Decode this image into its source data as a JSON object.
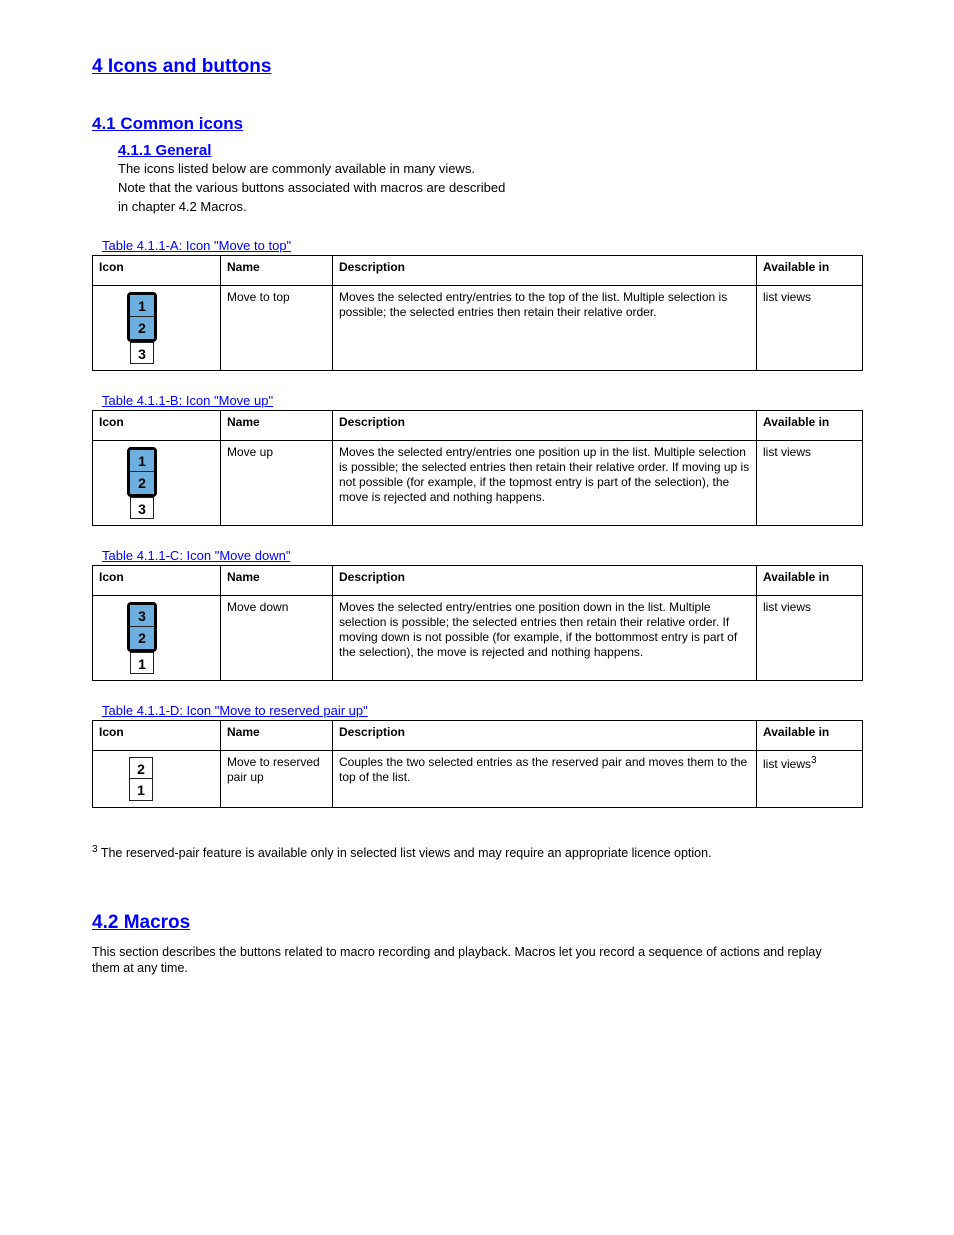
{
  "heading": "4   Icons and buttons",
  "sec4_1": {
    "title": "4.1   Common icons",
    "sub": {
      "title": "4.1.1   General",
      "text_1": "The icons listed below are commonly available in many views.",
      "text_2": "Note that the various buttons associated with macros are described",
      "text_3": "in chapter 4.2 Macros."
    }
  },
  "tableHeaders": [
    "Icon",
    "Name",
    "Description",
    "Available in"
  ],
  "tables": [
    {
      "caption": "Table 4.1.1-A: Icon \"Move to top\"",
      "icon": {
        "type": "dom_blue_top",
        "c1": "1",
        "c2": "2",
        "c3": "3"
      },
      "name": "Move to top",
      "desc": "Moves the selected entry/entries to the top of the list. Multiple selection is possible; the selected entries then retain their relative order.",
      "where": "list views"
    },
    {
      "caption": "Table 4.1.1-B: Icon \"Move up\"",
      "icon": {
        "type": "dom_blue_top",
        "c1": "1",
        "c2": "2",
        "c3": "3"
      },
      "name": "Move up",
      "desc": "Moves the selected entry/entries one position up in the list. Multiple selection is possible; the selected entries then retain their relative order. If moving up is not possible (for example, if the topmost entry is part of the selection), the move is rejected and nothing happens.",
      "where": "list views"
    },
    {
      "caption": "Table 4.1.1-C: Icon \"Move down\"",
      "icon": {
        "type": "dom_blue_top",
        "c1": "3",
        "c2": "2",
        "c3": "1"
      },
      "name": "Move down",
      "desc": "Moves the selected entry/entries one position down in the list. Multiple selection is possible; the selected entries then retain their relative order. If moving down is not possible (for example, if the bottommost entry is part of the selection), the move is rejected and nothing happens.",
      "where": "list views"
    },
    {
      "caption": "Table 4.1.1-D: Icon \"Move to reserved pair up\"",
      "icon": {
        "type": "res2",
        "c1": "2",
        "c2": "1"
      },
      "name": "Move to reserved pair up",
      "desc": "Couples the two selected entries as the reserved pair and moves them to the top of the list.",
      "where": "list views",
      "sup": "3"
    }
  ],
  "footnote": "The reserved-pair feature is available only in selected list views and may require an appropriate licence option.",
  "footnote_marker": "3",
  "footerHeading": "4.2   Macros",
  "footerText": "This section describes the buttons related to macro recording and playback. Macros let you record a sequence of actions and replay them at any time."
}
